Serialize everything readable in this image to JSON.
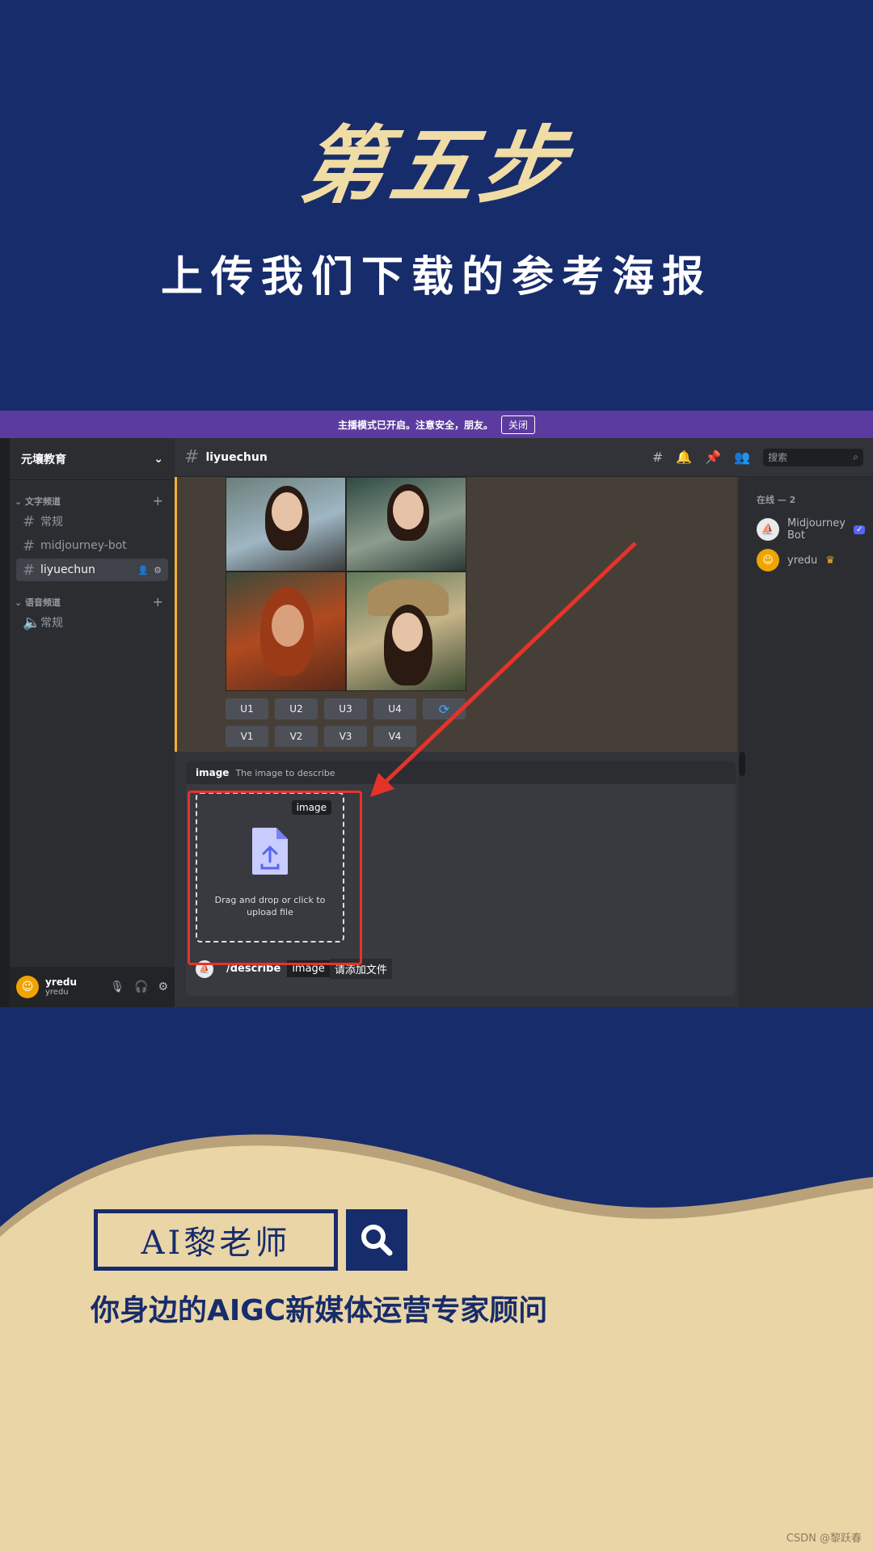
{
  "colors": {
    "background": "#172c6b",
    "accent_gold": "#f0dca5",
    "cream": "#ead5a6",
    "highlight_red": "#e6332a"
  },
  "header": {
    "title": "第五步",
    "subtitle": "上传我们下载的参考海报"
  },
  "discord": {
    "notice": {
      "text": "主播模式已开启。注意安全，朋友。",
      "close_label": "关闭"
    },
    "server": {
      "name": "元壤教育",
      "chevron_icon": "chevron-down-icon"
    },
    "categories": [
      {
        "label": "文字频道",
        "channels": [
          "常规",
          "midjourney-bot",
          "liyuechun"
        ]
      },
      {
        "label": "语音频道",
        "channels": [
          "常规"
        ]
      }
    ],
    "active_channel": "liyuechun",
    "search_placeholder": "搜索",
    "user": {
      "name": "yredu",
      "sub": "yredu"
    },
    "message": {
      "upscale_buttons": [
        "U1",
        "U2",
        "U3",
        "U4"
      ],
      "variation_buttons": [
        "V1",
        "V2",
        "V3",
        "V4"
      ],
      "refresh_icon": "refresh-icon"
    },
    "members": {
      "category": "在线 — 2",
      "list": [
        {
          "name": "Midjourney Bot",
          "badge": "✓"
        },
        {
          "name": "yredu",
          "badge": "♛"
        }
      ]
    },
    "composer": {
      "option_name": "image",
      "option_desc": "The image to describe",
      "upload_tag": "image",
      "upload_hint": "Drag and drop or click to upload file",
      "command": "/describe",
      "chip_name": "image",
      "chip_value": "请添加文件"
    }
  },
  "footer": {
    "brand": "AI黎老师",
    "tagline": "你身边的AIGC新媒体运营专家顾问",
    "credit": "CSDN @黎跃春"
  }
}
